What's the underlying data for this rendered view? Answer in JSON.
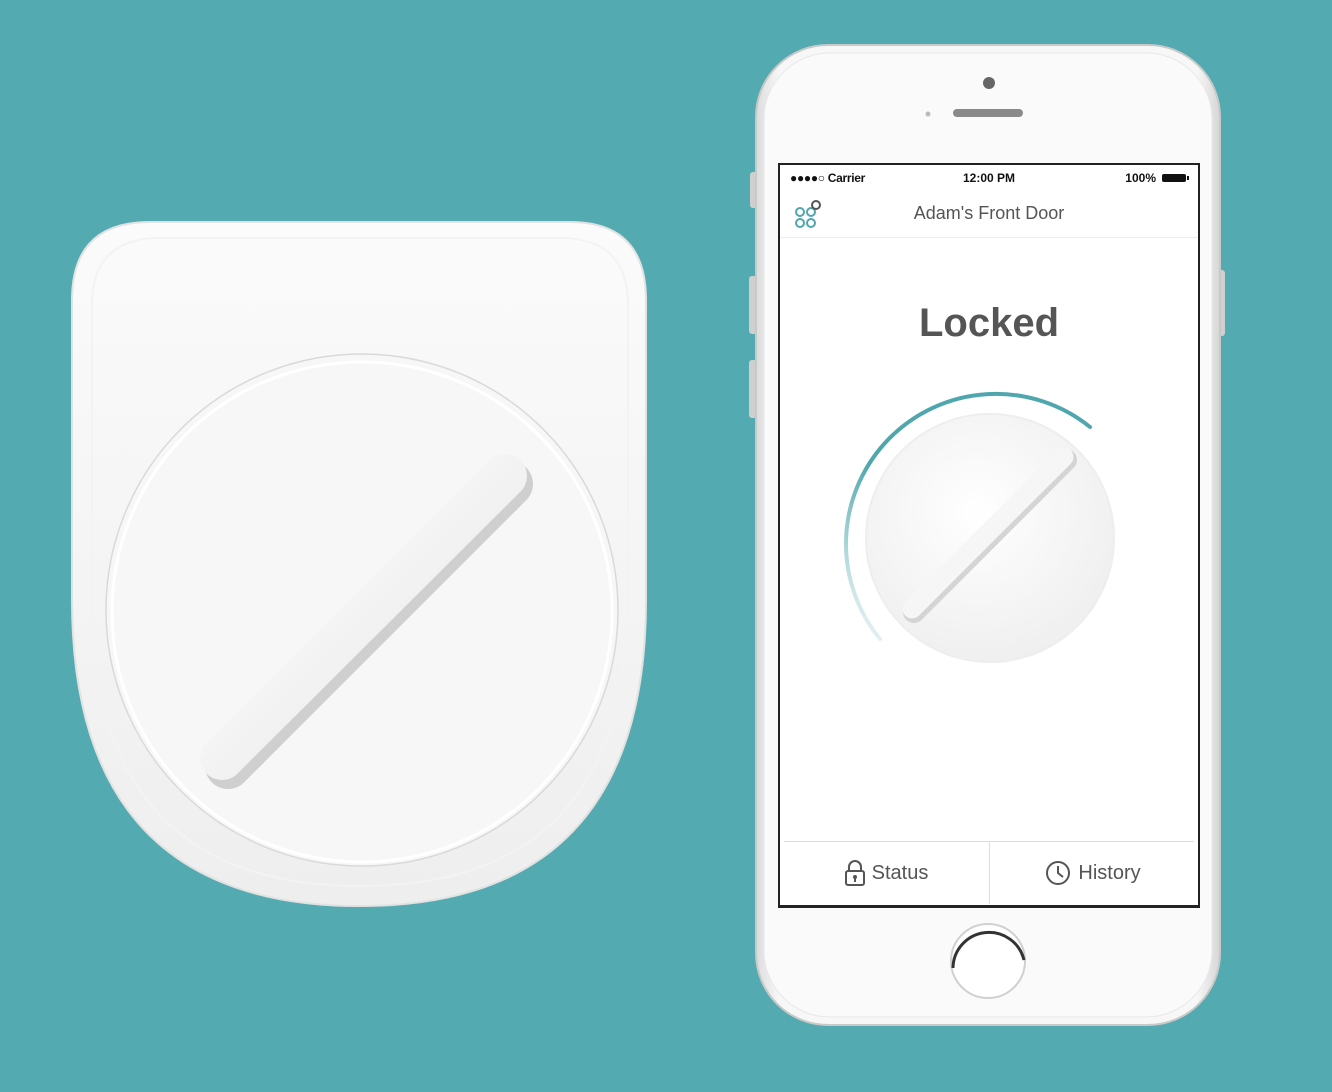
{
  "status_bar": {
    "carrier": "●●●●○ Carrier",
    "time": "12:00 PM",
    "battery": "100%"
  },
  "app": {
    "title": "Adam's Front Door",
    "menu_icon": "grid-icon",
    "lock_state": "Locked",
    "lock_progress": 0.55
  },
  "tabs": [
    {
      "label": "Status",
      "icon": "lock-icon"
    },
    {
      "label": "History",
      "icon": "clock-icon"
    }
  ],
  "colors": {
    "background": "#54aab1",
    "accent": "#4fa7ad",
    "text": "#555555"
  }
}
